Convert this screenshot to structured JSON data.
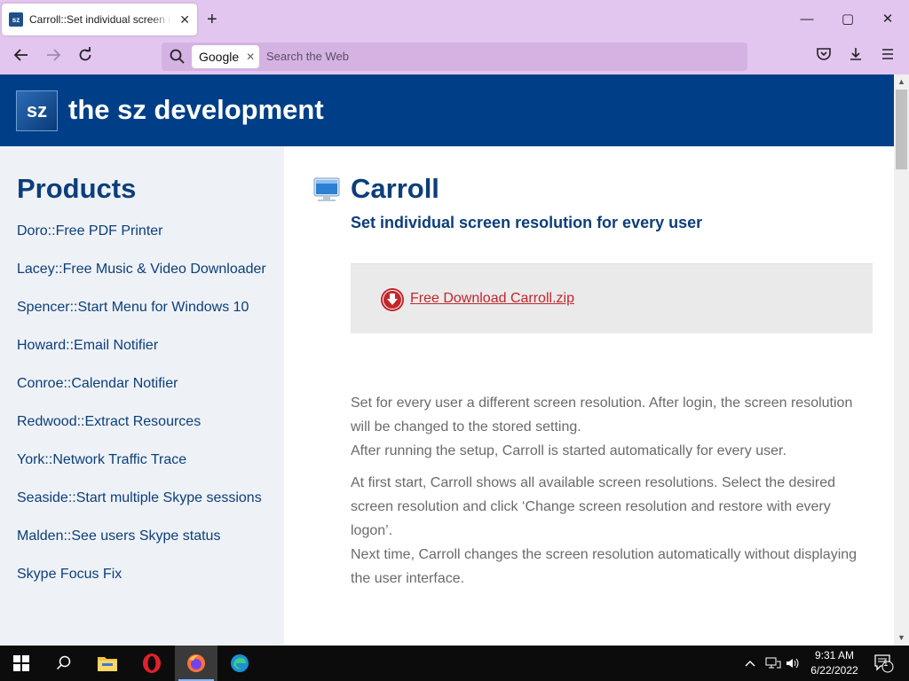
{
  "browser": {
    "tab_title": "Carroll::Set individual screen resolution for every user",
    "favicon_text": "sz",
    "new_tab_label": "+",
    "search_engine": "Google",
    "search_placeholder": "Search the Web"
  },
  "site": {
    "logo_text": "sz",
    "title": "the sz development"
  },
  "sidebar": {
    "heading": "Products",
    "items": [
      "Doro::Free PDF Printer",
      "Lacey::Free Music & Video Downloader",
      "Spencer::Start Menu for Windows 10",
      "Howard::Email Notifier",
      "Conroe::Calendar Notifier",
      "Redwood::Extract Resources",
      "York::Network Traffic Trace",
      "Seaside::Start multiple Skype sessions",
      "Malden::See users Skype status",
      "Skype Focus Fix"
    ]
  },
  "main": {
    "title": "Carroll",
    "subtitle": "Set individual screen resolution for every user",
    "download_link": "Free Download Carroll.zip",
    "paragraphs": [
      "Set for every user a different screen resolution. After login, the screen resolution will be changed to the stored setting.",
      "After running the setup, Carroll is started automatically for every user.",
      "At first start, Carroll shows all available screen resolutions. Select the desired screen resolution and click ‘Change screen resolution and restore with every logon’.",
      "Next time, Carroll changes the screen resolution automatically without displaying the user interface."
    ]
  },
  "taskbar": {
    "time": "9:31 AM",
    "date": "6/22/2022",
    "notification_count": "1"
  },
  "colors": {
    "header_bg": "#003f87",
    "sidebar_bg": "#eef2f7",
    "heading": "#0c3e7a",
    "download_link": "#c1272d",
    "browser_chrome": "#e3c6f0"
  }
}
